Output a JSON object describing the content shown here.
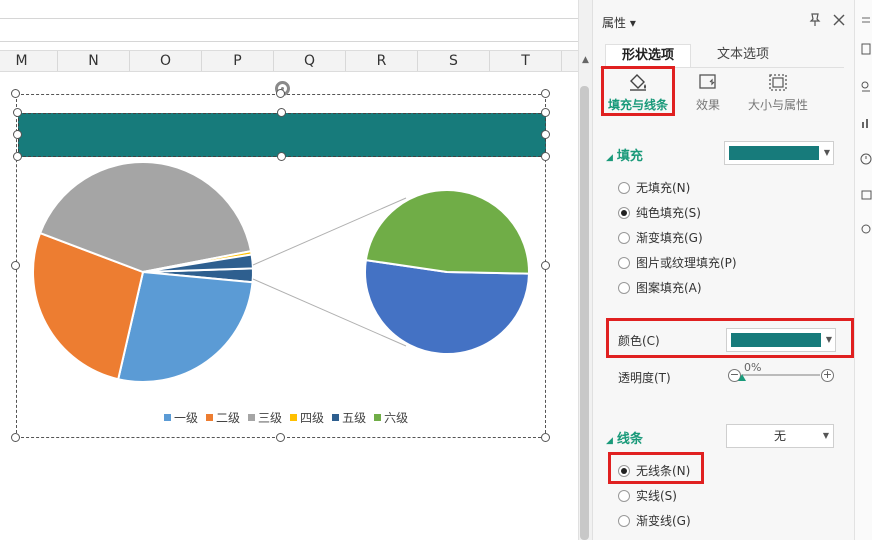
{
  "columns": [
    "M",
    "N",
    "O",
    "P",
    "Q",
    "R",
    "S",
    "T"
  ],
  "chart_data": {
    "type": "pie",
    "categories": [
      "一级",
      "二级",
      "三级",
      "四级",
      "五级",
      "六级"
    ],
    "values": [
      27,
      27,
      41,
      0.5,
      2,
      2
    ],
    "secondary_pie": {
      "type": "pie",
      "values": [
        52,
        48
      ],
      "colors": [
        "#4472c4",
        "#70ad47"
      ]
    },
    "colors": [
      "#5b9bd5",
      "#ed7d31",
      "#a5a5a5",
      "#ffc000",
      "#2e5f8f",
      "#70ad47"
    ],
    "legend_position": "bottom",
    "title": ""
  },
  "panel": {
    "title": "属性 ▾",
    "tabs": {
      "shape": "形状选项",
      "text": "文本选项"
    },
    "subtabs": {
      "fill": "填充与线条",
      "effect": "效果",
      "size": "大小与属性"
    },
    "fill": {
      "title": "填充",
      "color": "#177b7b",
      "options": [
        "无填充(N)",
        "纯色填充(S)",
        "渐变填充(G)",
        "图片或纹理填充(P)",
        "图案填充(A)"
      ],
      "selected_index": 1,
      "color_label": "颜色(C)",
      "transparency_label": "透明度(T)",
      "transparency_value": "0%"
    },
    "line": {
      "title": "线条",
      "dropdown_value": "无",
      "options": [
        "无线条(N)",
        "实线(S)",
        "渐变线(G)"
      ],
      "selected_index": 0
    }
  }
}
